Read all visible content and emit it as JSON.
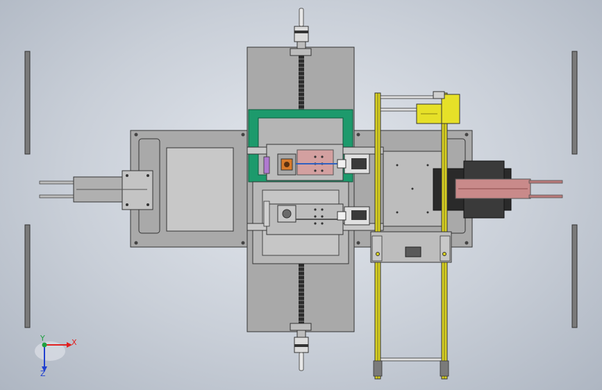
{
  "view": {
    "background_center": "#e4e8ee",
    "background_edge": "#aeb6c2"
  },
  "triad": {
    "x_label": "X",
    "y_label": "Y",
    "z_label": "Z",
    "x_color": "#e02020",
    "y_color": "#20a040",
    "z_color": "#2040d0"
  },
  "colors": {
    "frame_gray": "#bfbfbf",
    "plate_gray": "#a8a8a8",
    "dark_gray": "#6e6e6e",
    "green_frame": "#1d9a6c",
    "yellow_rail": "#d8d020",
    "yellow_motor": "#e6e028",
    "red_slider": "#c98a8a",
    "orange_part": "#d87a2a",
    "black_block": "#2a2a2a"
  },
  "icons": [
    "coordinate-triad-icon"
  ]
}
